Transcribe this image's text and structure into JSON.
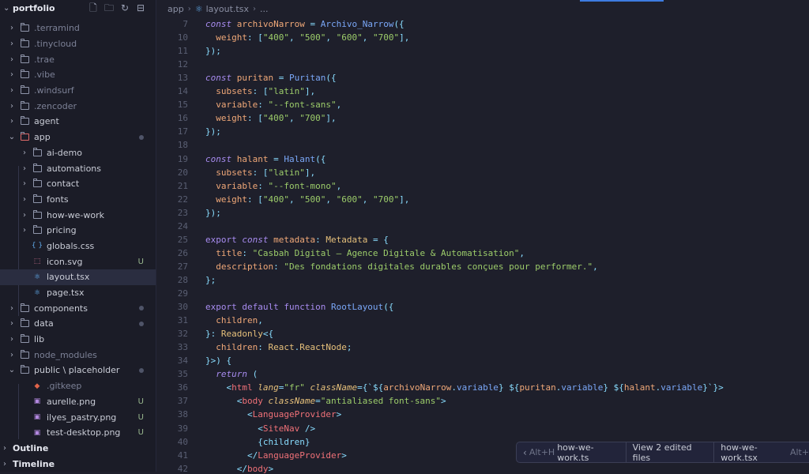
{
  "sidebar": {
    "title": "portfolio",
    "header_actions": [
      "new-file-icon",
      "new-folder-icon",
      "refresh-icon",
      "collapse-all-icon"
    ],
    "items": [
      {
        "label": ".terramind",
        "kind": "folder",
        "depth": 0,
        "dim": true
      },
      {
        "label": ".tinycloud",
        "kind": "folder",
        "depth": 0,
        "dim": true
      },
      {
        "label": ".trae",
        "kind": "folder",
        "depth": 0,
        "dim": true
      },
      {
        "label": ".vibe",
        "kind": "folder",
        "depth": 0,
        "dim": true
      },
      {
        "label": ".windsurf",
        "kind": "folder",
        "depth": 0,
        "dim": true
      },
      {
        "label": ".zencoder",
        "kind": "folder",
        "depth": 0,
        "dim": true
      },
      {
        "label": "agent",
        "kind": "folder",
        "depth": 0
      },
      {
        "label": "app",
        "kind": "folder-open",
        "depth": 0,
        "dot": true
      },
      {
        "label": "ai-demo",
        "kind": "folder",
        "depth": 1
      },
      {
        "label": "automations",
        "kind": "folder",
        "depth": 1
      },
      {
        "label": "contact",
        "kind": "folder",
        "depth": 1
      },
      {
        "label": "fonts",
        "kind": "folder",
        "depth": 1
      },
      {
        "label": "how-we-work",
        "kind": "folder",
        "depth": 1
      },
      {
        "label": "pricing",
        "kind": "folder",
        "depth": 1
      },
      {
        "label": "globals.css",
        "kind": "css",
        "depth": 1
      },
      {
        "label": "icon.svg",
        "kind": "svg",
        "depth": 1,
        "badge": "U"
      },
      {
        "label": "layout.tsx",
        "kind": "tsx",
        "depth": 1,
        "selected": true
      },
      {
        "label": "page.tsx",
        "kind": "tsx",
        "depth": 1
      },
      {
        "label": "components",
        "kind": "folder",
        "depth": 0,
        "dot": true
      },
      {
        "label": "data",
        "kind": "folder",
        "depth": 0,
        "dot": true
      },
      {
        "label": "lib",
        "kind": "folder",
        "depth": 0
      },
      {
        "label": "node_modules",
        "kind": "folder",
        "depth": 0,
        "dim": true
      },
      {
        "label": "public \\ placeholder",
        "kind": "folder-open",
        "depth": 0,
        "dot": true
      },
      {
        "label": ".gitkeep",
        "kind": "git",
        "depth": 1,
        "dim": true
      },
      {
        "label": "aurelle.png",
        "kind": "image",
        "depth": 1,
        "badge": "U"
      },
      {
        "label": "ilyes_pastry.png",
        "kind": "image",
        "depth": 1,
        "badge": "U"
      },
      {
        "label": "test-desktop.png",
        "kind": "image",
        "depth": 1,
        "badge": "U"
      }
    ],
    "outline_label": "Outline",
    "timeline_label": "Timeline"
  },
  "breadcrumb": {
    "segments": [
      "app",
      "layout.tsx",
      "..."
    ]
  },
  "editor": {
    "lines": [
      {
        "n": "7",
        "tokens": [
          [
            "const ",
            "kw"
          ],
          [
            "archivoNarrow",
            "pr"
          ],
          [
            " = ",
            "pu"
          ],
          [
            "Archivo_Narrow",
            "fn"
          ],
          [
            "({",
            "pu"
          ]
        ]
      },
      {
        "n": "10",
        "tokens": [
          [
            "  weight",
            "pr"
          ],
          [
            ": ",
            "pu"
          ],
          [
            "[",
            "pu"
          ],
          [
            "\"400\"",
            "st"
          ],
          [
            ", ",
            "pu"
          ],
          [
            "\"500\"",
            "st"
          ],
          [
            ", ",
            "pu"
          ],
          [
            "\"600\"",
            "st"
          ],
          [
            ", ",
            "pu"
          ],
          [
            "\"700\"",
            "st"
          ],
          [
            "],",
            "pu"
          ]
        ]
      },
      {
        "n": "11",
        "tokens": [
          [
            "});",
            "pu"
          ]
        ]
      },
      {
        "n": "12",
        "tokens": []
      },
      {
        "n": "13",
        "tokens": [
          [
            "const ",
            "kw"
          ],
          [
            "puritan",
            "pr"
          ],
          [
            " = ",
            "pu"
          ],
          [
            "Puritan",
            "fn"
          ],
          [
            "({",
            "pu"
          ]
        ]
      },
      {
        "n": "14",
        "tokens": [
          [
            "  subsets",
            "pr"
          ],
          [
            ": ",
            "pu"
          ],
          [
            "[",
            "pu"
          ],
          [
            "\"latin\"",
            "st"
          ],
          [
            "],",
            "pu"
          ]
        ]
      },
      {
        "n": "15",
        "tokens": [
          [
            "  variable",
            "pr"
          ],
          [
            ": ",
            "pu"
          ],
          [
            "\"--font-sans\"",
            "st"
          ],
          [
            ",",
            "pu"
          ]
        ]
      },
      {
        "n": "16",
        "tokens": [
          [
            "  weight",
            "pr"
          ],
          [
            ": ",
            "pu"
          ],
          [
            "[",
            "pu"
          ],
          [
            "\"400\"",
            "st"
          ],
          [
            ", ",
            "pu"
          ],
          [
            "\"700\"",
            "st"
          ],
          [
            "],",
            "pu"
          ]
        ]
      },
      {
        "n": "17",
        "tokens": [
          [
            "});",
            "pu"
          ]
        ]
      },
      {
        "n": "18",
        "tokens": []
      },
      {
        "n": "19",
        "tokens": [
          [
            "const ",
            "kw"
          ],
          [
            "halant",
            "pr"
          ],
          [
            " = ",
            "pu"
          ],
          [
            "Halant",
            "fn"
          ],
          [
            "({",
            "pu"
          ]
        ]
      },
      {
        "n": "20",
        "tokens": [
          [
            "  subsets",
            "pr"
          ],
          [
            ": ",
            "pu"
          ],
          [
            "[",
            "pu"
          ],
          [
            "\"latin\"",
            "st"
          ],
          [
            "],",
            "pu"
          ]
        ]
      },
      {
        "n": "21",
        "tokens": [
          [
            "  variable",
            "pr"
          ],
          [
            ": ",
            "pu"
          ],
          [
            "\"--font-mono\"",
            "st"
          ],
          [
            ",",
            "pu"
          ]
        ]
      },
      {
        "n": "22",
        "tokens": [
          [
            "  weight",
            "pr"
          ],
          [
            ": ",
            "pu"
          ],
          [
            "[",
            "pu"
          ],
          [
            "\"400\"",
            "st"
          ],
          [
            ", ",
            "pu"
          ],
          [
            "\"500\"",
            "st"
          ],
          [
            ", ",
            "pu"
          ],
          [
            "\"600\"",
            "st"
          ],
          [
            ", ",
            "pu"
          ],
          [
            "\"700\"",
            "st"
          ],
          [
            "],",
            "pu"
          ]
        ]
      },
      {
        "n": "23",
        "tokens": [
          [
            "});",
            "pu"
          ]
        ]
      },
      {
        "n": "24",
        "tokens": []
      },
      {
        "n": "25",
        "tokens": [
          [
            "export ",
            "kw2"
          ],
          [
            "const ",
            "kw"
          ],
          [
            "metadata",
            "pr"
          ],
          [
            ": ",
            "pu"
          ],
          [
            "Metadata",
            "ty"
          ],
          [
            " = {",
            "pu"
          ]
        ]
      },
      {
        "n": "26",
        "tokens": [
          [
            "  title",
            "pr"
          ],
          [
            ": ",
            "pu"
          ],
          [
            "\"Casbah Digital — Agence Digitale & Automatisation\"",
            "st"
          ],
          [
            ",",
            "pu"
          ]
        ]
      },
      {
        "n": "27",
        "tokens": [
          [
            "  description",
            "pr"
          ],
          [
            ": ",
            "pu"
          ],
          [
            "\"Des fondations digitales durables conçues pour performer.\"",
            "st"
          ],
          [
            ",",
            "pu"
          ]
        ]
      },
      {
        "n": "28",
        "tokens": [
          [
            "};",
            "pu"
          ]
        ]
      },
      {
        "n": "29",
        "tokens": []
      },
      {
        "n": "30",
        "tokens": [
          [
            "export ",
            "kw2"
          ],
          [
            "default ",
            "kw2"
          ],
          [
            "function ",
            "kw2"
          ],
          [
            "RootLayout",
            "fn"
          ],
          [
            "({",
            "pu"
          ]
        ]
      },
      {
        "n": "31",
        "tokens": [
          [
            "  children",
            "pr"
          ],
          [
            ",",
            "pu"
          ]
        ]
      },
      {
        "n": "32",
        "tokens": [
          [
            "}: ",
            "pu"
          ],
          [
            "Readonly",
            "ty"
          ],
          [
            "<{",
            "pu"
          ]
        ]
      },
      {
        "n": "33",
        "tokens": [
          [
            "  children",
            "pr"
          ],
          [
            ": ",
            "pu"
          ],
          [
            "React",
            "ty"
          ],
          [
            ".",
            "pu"
          ],
          [
            "ReactNode",
            "ty"
          ],
          [
            ";",
            "pu"
          ]
        ]
      },
      {
        "n": "34",
        "tokens": [
          [
            "}>) {",
            "pu"
          ]
        ]
      },
      {
        "n": "35",
        "tokens": [
          [
            "  return ",
            "kw"
          ],
          [
            "(",
            "pu"
          ]
        ]
      },
      {
        "n": "36",
        "tokens": [
          [
            "    <",
            "pu"
          ],
          [
            "html ",
            "tg"
          ],
          [
            "lang",
            "at"
          ],
          [
            "=",
            "pu"
          ],
          [
            "\"fr\" ",
            "st"
          ],
          [
            "className",
            "at"
          ],
          [
            "={`",
            "pu"
          ],
          [
            "${",
            "pu"
          ],
          [
            "archivoNarrow",
            "pr"
          ],
          [
            ".",
            "pu"
          ],
          [
            "variable",
            "fn"
          ],
          [
            "} ",
            "pu"
          ],
          [
            "${",
            "pu"
          ],
          [
            "puritan",
            "pr"
          ],
          [
            ".",
            "pu"
          ],
          [
            "variable",
            "fn"
          ],
          [
            "} ",
            "pu"
          ],
          [
            "${",
            "pu"
          ],
          [
            "halant",
            "pr"
          ],
          [
            ".",
            "pu"
          ],
          [
            "variable",
            "fn"
          ],
          [
            "}`}>",
            "pu"
          ]
        ]
      },
      {
        "n": "37",
        "tokens": [
          [
            "      <",
            "pu"
          ],
          [
            "body ",
            "tg"
          ],
          [
            "className",
            "at"
          ],
          [
            "=",
            "pu"
          ],
          [
            "\"antialiased font-sans\"",
            "st"
          ],
          [
            ">",
            "pu"
          ]
        ]
      },
      {
        "n": "38",
        "tokens": [
          [
            "        <",
            "pu"
          ],
          [
            "LanguageProvider",
            "tg"
          ],
          [
            ">",
            "pu"
          ]
        ]
      },
      {
        "n": "39",
        "tokens": [
          [
            "          <",
            "pu"
          ],
          [
            "SiteNav ",
            "tg"
          ],
          [
            "/>",
            "pu"
          ]
        ]
      },
      {
        "n": "40",
        "tokens": [
          [
            "          {children}",
            "pu"
          ]
        ]
      },
      {
        "n": "41",
        "tokens": [
          [
            "        </",
            "pu"
          ],
          [
            "LanguageProvider",
            "tg"
          ],
          [
            ">",
            "pu"
          ]
        ]
      },
      {
        "n": "42",
        "tokens": [
          [
            "      </",
            "pu"
          ],
          [
            "body",
            "tg"
          ],
          [
            ">",
            "pu"
          ]
        ]
      }
    ]
  },
  "review_bar": {
    "prev_shortcut": "Alt+H",
    "prev_file": "how-we-work.ts",
    "center_label": "View 2 edited files",
    "next_file": "how-we-work.tsx",
    "next_shortcut": "Alt+L"
  },
  "colors": {
    "accent": "#3d7be0",
    "background": "#1e1f2b",
    "sidebar": "#1b1c27"
  }
}
